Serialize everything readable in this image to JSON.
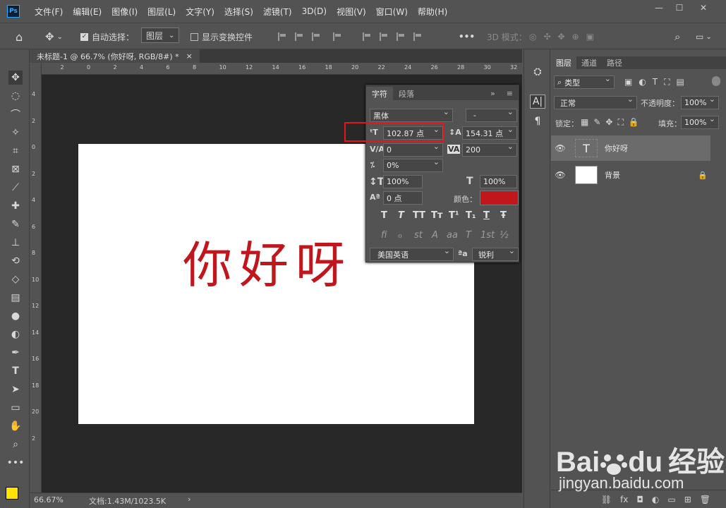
{
  "app": {
    "logo_text": "Ps"
  },
  "menu": [
    "文件(F)",
    "编辑(E)",
    "图像(I)",
    "图层(L)",
    "文字(Y)",
    "选择(S)",
    "滤镜(T)",
    "3D(D)",
    "视图(V)",
    "窗口(W)",
    "帮助(H)"
  ],
  "window": {
    "minimize": "—",
    "maximize": "☐",
    "close": "✕"
  },
  "options": {
    "auto_select_label": "自动选择：",
    "auto_select_value": "图层",
    "transform_label": "显示变换控件",
    "more": "•••",
    "mode3d": "3D 模式："
  },
  "doc_tab": {
    "title": "未标题-1 @ 66.7% (你好呀, RGB/8#) *",
    "close": "×"
  },
  "ruler_h": [
    "4",
    "2",
    "0",
    "2",
    "4",
    "6",
    "8",
    "10",
    "12",
    "14",
    "16",
    "18",
    "20",
    "22",
    "24",
    "26",
    "28",
    "30",
    "32"
  ],
  "ruler_v": [
    "4",
    "2",
    "0",
    "2",
    "4",
    "6",
    "8",
    "10",
    "12",
    "14",
    "16",
    "18",
    "20",
    "2"
  ],
  "canvas": {
    "text": "你好呀",
    "text_color": "#c0161c"
  },
  "status": {
    "zoom": "66.67%",
    "doc": "文档:1.43M/1023.5K",
    "arrow": "›"
  },
  "char_panel": {
    "tabs": [
      "字符",
      "段落"
    ],
    "font_family": "黑体",
    "font_style": "-",
    "font_size": "102.87 点",
    "leading": "154.31 点",
    "kerning": "0",
    "tracking": "200",
    "scale_pct": "0%",
    "vscale": "100%",
    "hscale": "100%",
    "baseline": "0 点",
    "color_label": "颜色：",
    "color": "#c0161c",
    "styles": [
      "T",
      "T",
      "TT",
      "Tт",
      "T¹",
      "T₁",
      "T",
      "Ŧ"
    ],
    "opentype": [
      "fi",
      "ℴ",
      "st",
      "A",
      "aa",
      "T",
      "1st",
      "½"
    ],
    "language": "美国英语",
    "aa_label": "ªa",
    "aa_mode": "锐利",
    "menu_icon": "≡",
    "collapse_icon": "»"
  },
  "layers_panel": {
    "tabs": [
      "图层",
      "通道",
      "路径"
    ],
    "filter_label": "类型",
    "blend_mode": "正常",
    "opacity_label": "不透明度：",
    "opacity": "100%",
    "lock_label": "锁定：",
    "fill_label": "填充：",
    "fill": "100%",
    "layers": [
      {
        "name": "你好呀",
        "thumb": "T"
      },
      {
        "name": "背景",
        "thumb": ""
      }
    ],
    "bottom_icons": [
      "⛓",
      "fx",
      "◘",
      "◐",
      "▭",
      "⊞",
      "🗑"
    ]
  },
  "watermark": {
    "brand": "Bai",
    "brand2": "du",
    "cn": "经验",
    "url": "jingyan.baidu.com"
  }
}
